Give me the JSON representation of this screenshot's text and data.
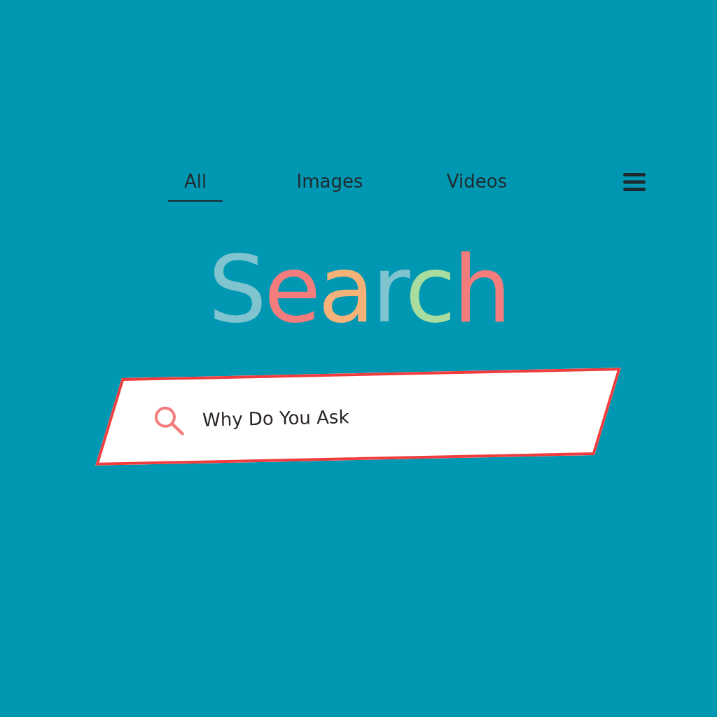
{
  "tabs": [
    {
      "label": "All",
      "selected": true
    },
    {
      "label": "Images",
      "selected": false
    },
    {
      "label": "Videos",
      "selected": false
    }
  ],
  "logo": [
    {
      "text": "S",
      "color": "#7fc4cf"
    },
    {
      "text": "e",
      "color": "#f47c7c"
    },
    {
      "text": "a",
      "color": "#f7b27a"
    },
    {
      "text": "r",
      "color": "#7fc4cf"
    },
    {
      "text": "c",
      "color": "#a8dd9f"
    },
    {
      "text": "h",
      "color": "#f47c7c"
    }
  ],
  "search": {
    "value": "Why Do You Ask"
  }
}
